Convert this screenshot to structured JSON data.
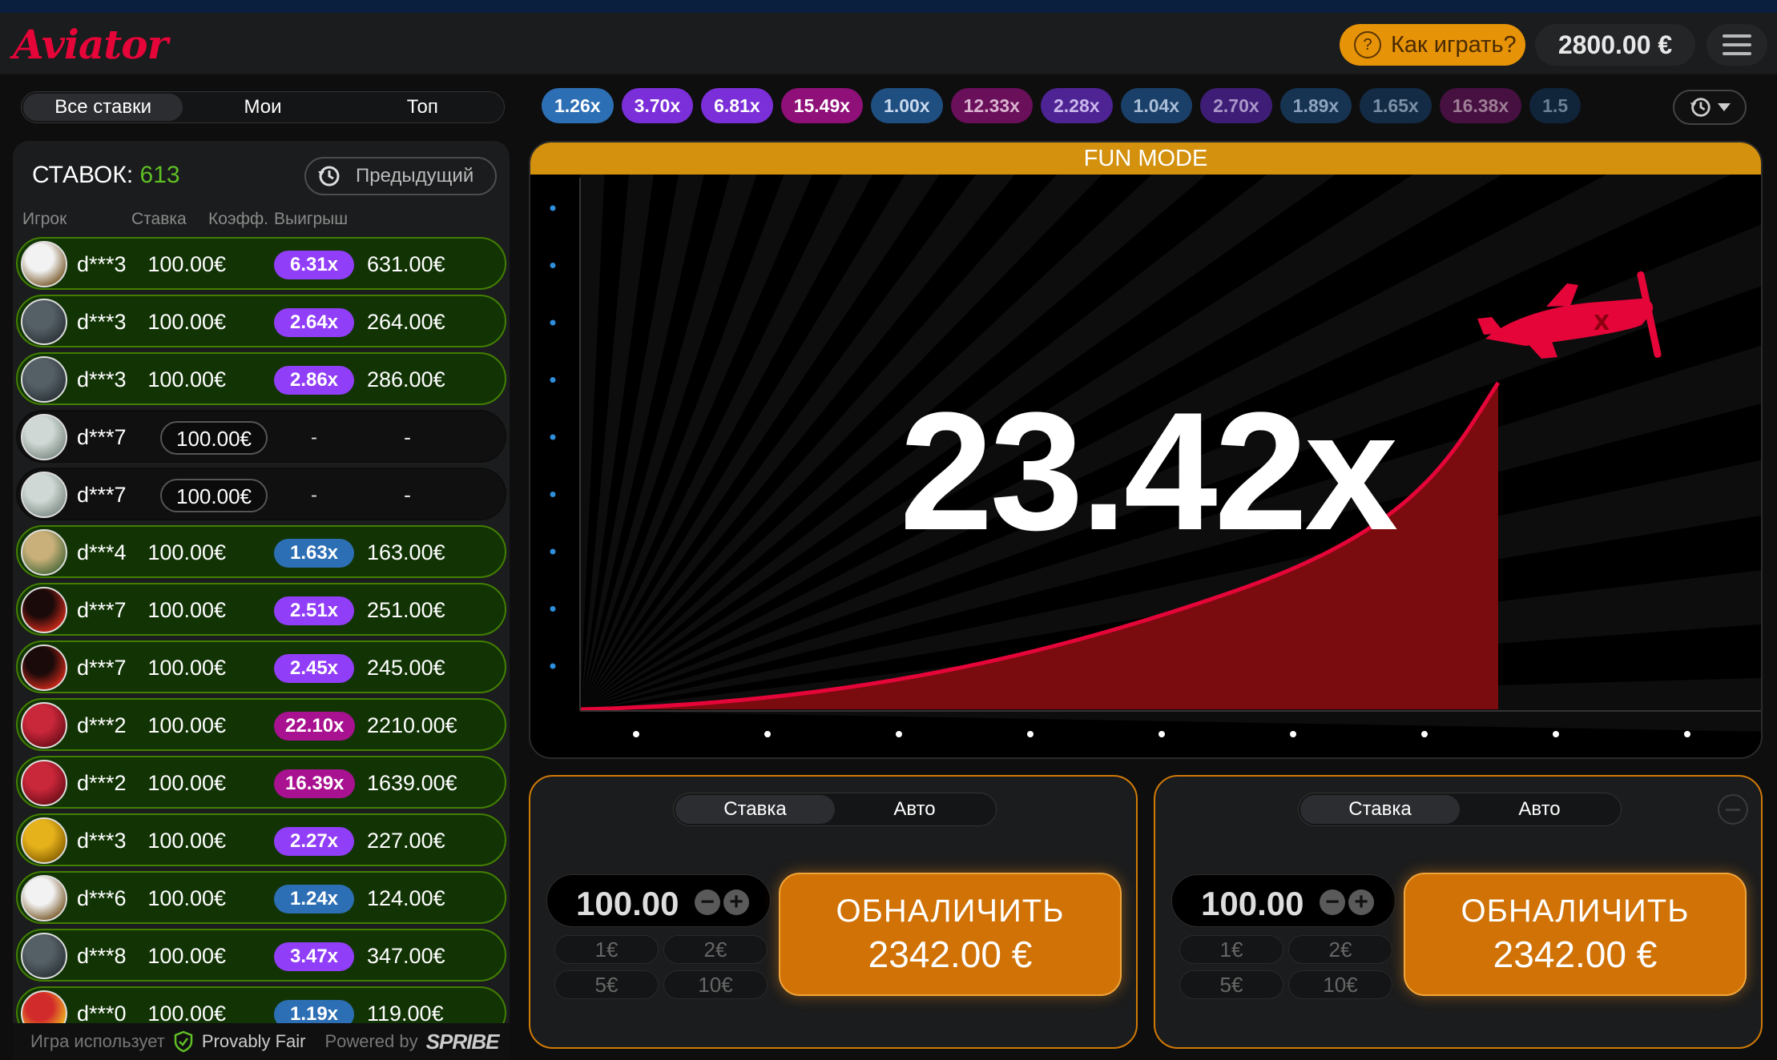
{
  "header": {
    "logo": "Aviator",
    "how_to_play": "Как играть?",
    "balance": "2800.00 €"
  },
  "bet_tabs": [
    "Все ставки",
    "Мои",
    "Топ"
  ],
  "bets_panel": {
    "count_label": "СТАВОК:",
    "count_value": "613",
    "previous_button": "Предыдущий",
    "columns": [
      "Игрок",
      "Ставка",
      "Коэфф.",
      "Выигрыш"
    ],
    "rows": [
      {
        "player": "d***3",
        "bet": "100.00€",
        "coef": "6.31x",
        "coef_color": "#913ef8",
        "win": "631.00€",
        "status": "won",
        "avatar": "eagle-avatar"
      },
      {
        "player": "d***3",
        "bet": "100.00€",
        "coef": "2.64x",
        "coef_color": "#913ef8",
        "win": "264.00€",
        "status": "won",
        "avatar": "dragon-avatar"
      },
      {
        "player": "d***3",
        "bet": "100.00€",
        "coef": "2.86x",
        "coef_color": "#913ef8",
        "win": "286.00€",
        "status": "won",
        "avatar": "dragon-avatar"
      },
      {
        "player": "d***7",
        "bet": "100.00€",
        "coef": "-",
        "coef_color": "",
        "win": "-",
        "status": "active",
        "avatar": "money-avatar"
      },
      {
        "player": "d***7",
        "bet": "100.00€",
        "coef": "-",
        "coef_color": "",
        "win": "-",
        "status": "active",
        "avatar": "money-avatar"
      },
      {
        "player": "d***4",
        "bet": "100.00€",
        "coef": "1.63x",
        "coef_color": "#2d6fb4",
        "win": "163.00€",
        "status": "won",
        "avatar": "cash-avatar"
      },
      {
        "player": "d***7",
        "bet": "100.00€",
        "coef": "2.51x",
        "coef_color": "#913ef8",
        "win": "251.00€",
        "status": "won",
        "avatar": "mask-avatar"
      },
      {
        "player": "d***7",
        "bet": "100.00€",
        "coef": "2.45x",
        "coef_color": "#913ef8",
        "win": "245.00€",
        "status": "won",
        "avatar": "mask-avatar"
      },
      {
        "player": "d***2",
        "bet": "100.00€",
        "coef": "22.10x",
        "coef_color": "#a8118f",
        "win": "2210.00€",
        "status": "won",
        "avatar": "rose-avatar"
      },
      {
        "player": "d***2",
        "bet": "100.00€",
        "coef": "16.39x",
        "coef_color": "#a8118f",
        "win": "1639.00€",
        "status": "won",
        "avatar": "rose-avatar"
      },
      {
        "player": "d***3",
        "bet": "100.00€",
        "coef": "2.27x",
        "coef_color": "#913ef8",
        "win": "227.00€",
        "status": "won",
        "avatar": "gold-avatar"
      },
      {
        "player": "d***6",
        "bet": "100.00€",
        "coef": "1.24x",
        "coef_color": "#2d6fb4",
        "win": "124.00€",
        "status": "won",
        "avatar": "eagle-avatar"
      },
      {
        "player": "d***8",
        "bet": "100.00€",
        "coef": "3.47x",
        "coef_color": "#913ef8",
        "win": "347.00€",
        "status": "won",
        "avatar": "dragon-avatar"
      },
      {
        "player": "d***0",
        "bet": "100.00€",
        "coef": "1.19x",
        "coef_color": "#2d6fb4",
        "win": "119.00€",
        "status": "won",
        "avatar": "clown-avatar"
      }
    ]
  },
  "footer": {
    "uses": "Игра использует",
    "provably_fair": "Provably Fair",
    "powered_by": "Powered by",
    "brand": "SPRIBE"
  },
  "history": [
    {
      "value": "1.26x",
      "color": "#2d6fb4",
      "text_color": "#fff"
    },
    {
      "value": "3.70x",
      "color": "#7a2fd8",
      "text_color": "#fff"
    },
    {
      "value": "6.81x",
      "color": "#7a2fd8",
      "text_color": "#fff"
    },
    {
      "value": "15.49x",
      "color": "#8f1078",
      "text_color": "#fff"
    },
    {
      "value": "1.00x",
      "color": "#1f4e80",
      "text_color": "#c9d9ee"
    },
    {
      "value": "12.33x",
      "color": "#6a0f5a",
      "text_color": "#d9b4d0"
    },
    {
      "value": "2.28x",
      "color": "#4e2394",
      "text_color": "#c9b6ea"
    },
    {
      "value": "1.04x",
      "color": "#1a3f68",
      "text_color": "#a9bdd6"
    },
    {
      "value": "2.70x",
      "color": "#3e1d76",
      "text_color": "#a997c8"
    },
    {
      "value": "1.89x",
      "color": "#163352",
      "text_color": "#8da3bd"
    },
    {
      "value": "1.65x",
      "color": "#132b45",
      "text_color": "#7c90a7"
    },
    {
      "value": "16.38x",
      "color": "#461040",
      "text_color": "#9d7d96"
    },
    {
      "value": "1.5",
      "color": "#10243a",
      "text_color": "#6c8096"
    }
  ],
  "game": {
    "mode_label": "FUN MODE",
    "multiplier": "23.42x",
    "plane_color": "#e50539"
  },
  "bet_panel_1": {
    "tabs": [
      "Ставка",
      "Авто"
    ],
    "stake": "100.00",
    "quick_bets": [
      "1€",
      "2€",
      "5€",
      "10€"
    ],
    "cashout_label": "ОБНАЛИЧИТЬ",
    "cashout_amount": "2342.00 €"
  },
  "bet_panel_2": {
    "tabs": [
      "Ставка",
      "Авто"
    ],
    "stake": "100.00",
    "quick_bets": [
      "1€",
      "2€",
      "5€",
      "10€"
    ],
    "cashout_label": "ОБНАЛИЧИТЬ",
    "cashout_amount": "2342.00 €"
  }
}
